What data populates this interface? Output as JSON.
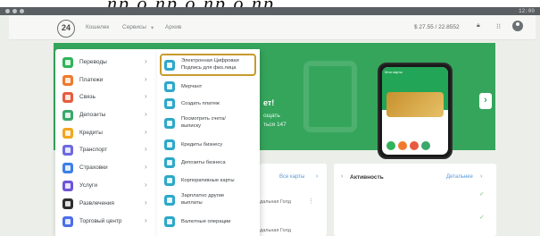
{
  "overlay": {
    "caption": "пр о пр о пр о пр"
  },
  "os_bar": {
    "time": "12:00"
  },
  "header": {
    "logo": "24",
    "nav": [
      "Кошелек",
      "Сервисы",
      "Архив"
    ],
    "balance": "$ 27.55 / 22.8552"
  },
  "banner": {
    "line1": "ет!",
    "line2": "ощать",
    "line3": "ться 147",
    "phone_card_title": "Мои карты",
    "colors": {
      "bg": "#35a55c",
      "card": "#d6a44a"
    }
  },
  "menu": {
    "items": [
      {
        "label": "Переводы",
        "color": "#2fb35b"
      },
      {
        "label": "Платежи",
        "color": "#ef7a2d"
      },
      {
        "label": "Связь",
        "color": "#e85b3e"
      },
      {
        "label": "Депозиты",
        "color": "#3aa86b"
      },
      {
        "label": "Кредиты",
        "color": "#f2a61f"
      },
      {
        "label": "Транспорт",
        "color": "#6d6adf"
      },
      {
        "label": "Страховки",
        "color": "#3d7ee8"
      },
      {
        "label": "Услуги",
        "color": "#6e55d6"
      },
      {
        "label": "Развлечения",
        "color": "#2d2d2d"
      },
      {
        "label": "Торговый центр",
        "color": "#4c6eea"
      }
    ]
  },
  "submenu": {
    "items": [
      {
        "label": "Электронная Цифровая Подпись для физ.лица"
      },
      {
        "label": "Мерчант"
      },
      {
        "label": "Создать платеж"
      },
      {
        "label": "Посмотреть счета/ выписку"
      },
      {
        "label": "Кредиты бизнесу"
      },
      {
        "label": "Депозиты бизнеса"
      },
      {
        "label": "Корпоративные карты"
      },
      {
        "label": "Зарплатно другие выплаты"
      },
      {
        "label": "Валютные операции"
      }
    ]
  },
  "cards_panel": {
    "link": "Все карты",
    "row1": "дальная Голд",
    "row2": "дальная Голд"
  },
  "activity_panel": {
    "title": "Активность",
    "link": "Детальнее"
  }
}
